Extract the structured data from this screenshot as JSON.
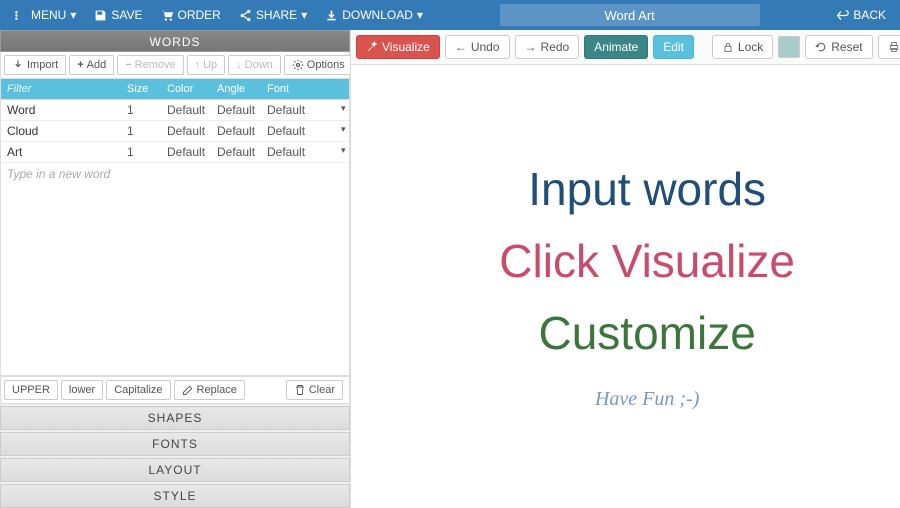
{
  "nav": {
    "menu": "MENU",
    "save": "SAVE",
    "order": "ORDER",
    "share": "SHARE",
    "download": "DOWNLOAD",
    "back": "BACK",
    "title": "Word Art"
  },
  "left": {
    "words_header": "WORDS",
    "import": "Import",
    "add": "Add",
    "remove": "Remove",
    "up": "Up",
    "down": "Down",
    "options": "Options",
    "filter_placeholder": "Filter",
    "cols": {
      "size": "Size",
      "color": "Color",
      "angle": "Angle",
      "font": "Font"
    },
    "rows": [
      {
        "word": "Word",
        "size": "1",
        "color": "Default",
        "angle": "Default",
        "font": "Default"
      },
      {
        "word": "Cloud",
        "size": "1",
        "color": "Default",
        "angle": "Default",
        "font": "Default"
      },
      {
        "word": "Art",
        "size": "1",
        "color": "Default",
        "angle": "Default",
        "font": "Default"
      }
    ],
    "new_word": "Type in a new word",
    "upper": "UPPER",
    "lower": "lower",
    "capitalize": "Capitalize",
    "replace": "Replace",
    "clear": "Clear",
    "acc": {
      "shapes": "SHAPES",
      "fonts": "FONTS",
      "layout": "LAYOUT",
      "style": "STYLE"
    }
  },
  "right": {
    "visualize": "Visualize",
    "undo": "Undo",
    "redo": "Redo",
    "animate": "Animate",
    "edit": "Edit",
    "lock": "Lock",
    "reset": "Reset",
    "print": "Print",
    "line1": "Input words",
    "line2": "Click Visualize",
    "line3": "Customize",
    "fun": "Have Fun ;-)"
  }
}
